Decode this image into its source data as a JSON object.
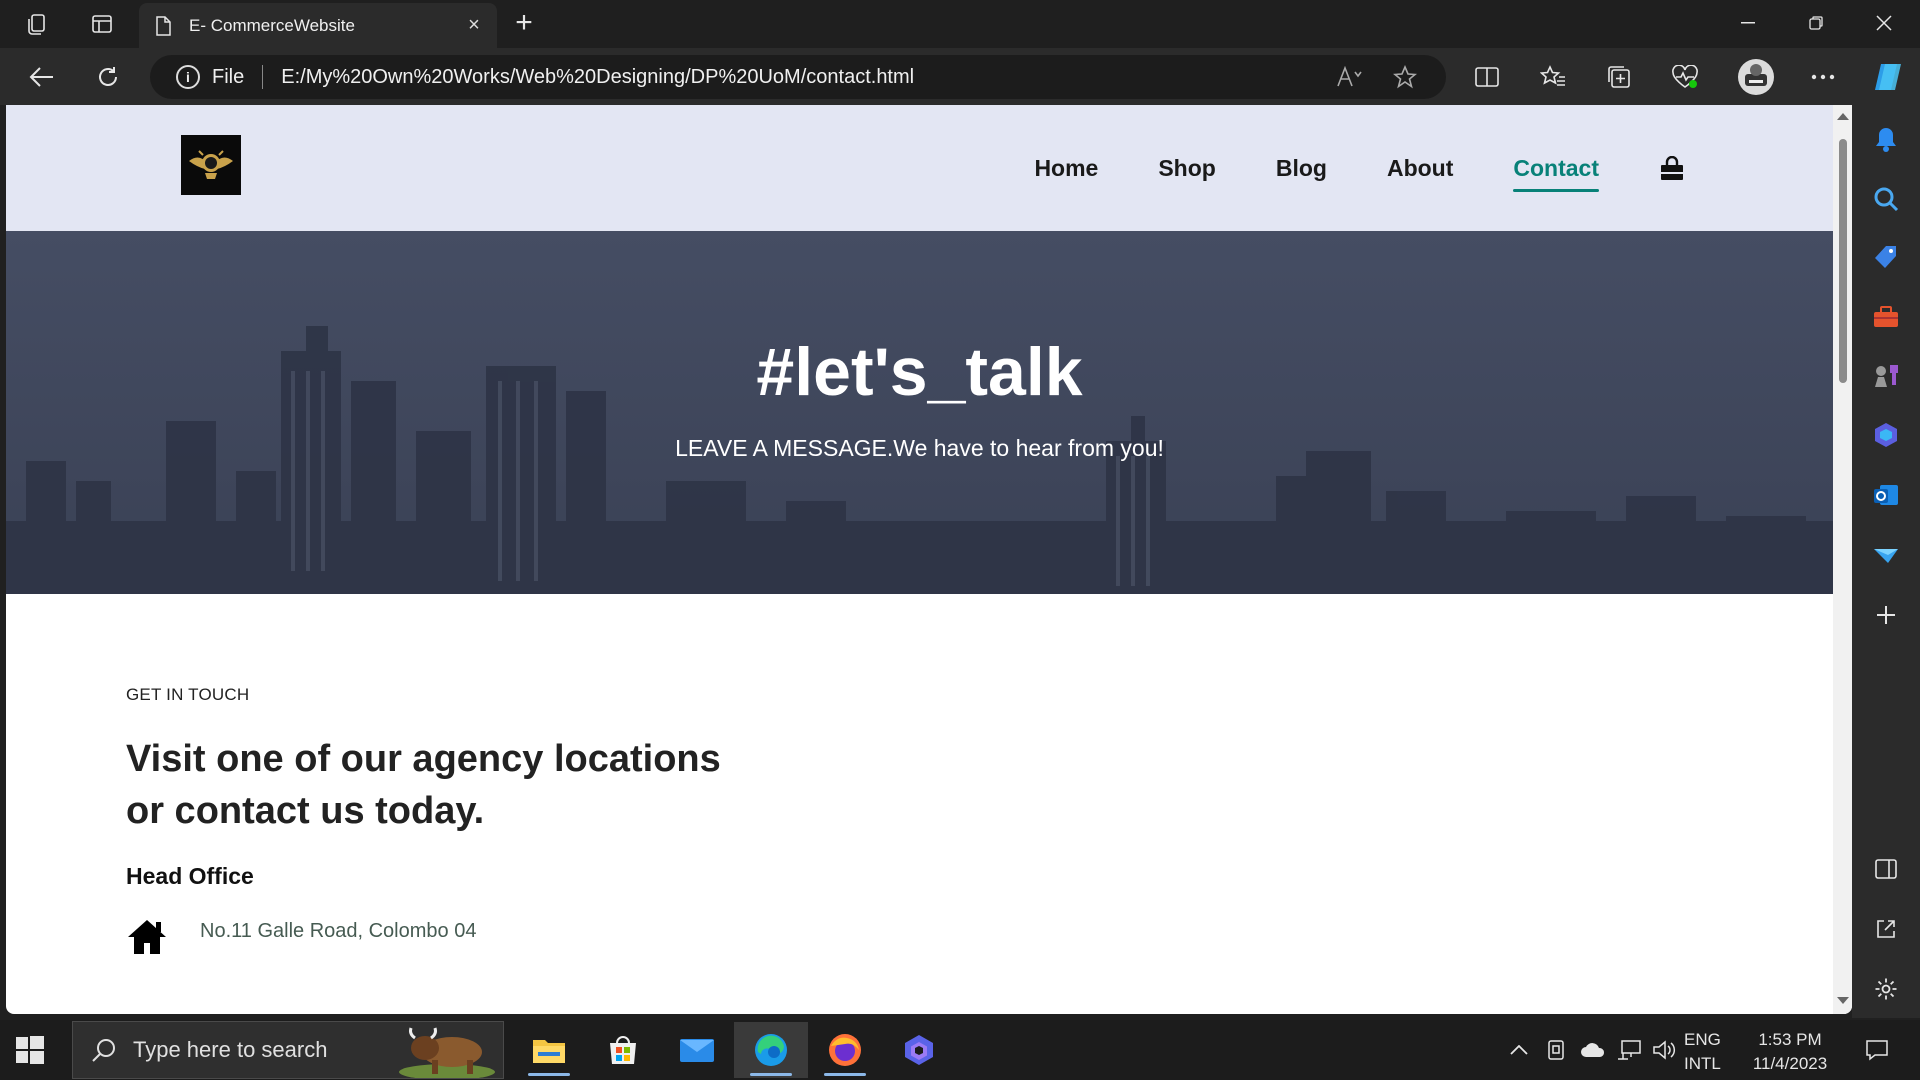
{
  "browser": {
    "tab_title": "E- CommerceWebsite",
    "tab_close": "×",
    "new_tab": "+",
    "url_scheme": "File",
    "url": "E:/My%20Own%20Works/Web%20Designing/DP%20UoM/contact.html",
    "read_aloud_icon": "A⁾"
  },
  "site": {
    "nav": [
      "Home",
      "Shop",
      "Blog",
      "About",
      "Contact"
    ],
    "active_nav": "Contact",
    "accent_color": "#088178",
    "header_bg": "#e3e6f3",
    "hero": {
      "title": "#let's_talk",
      "subtitle": "LEAVE A MESSAGE.We have to hear from you!"
    },
    "contact": {
      "kicker": "GET IN TOUCH",
      "heading_line1": "Visit one of our agency locations",
      "heading_line2": "or contact us today.",
      "office_title": "Head Office",
      "address": "No.11 Galle Road, Colombo 04"
    }
  },
  "taskbar": {
    "search_placeholder": "Type here to search",
    "lang_top": "ENG",
    "lang_bottom": "INTL",
    "time": "1:53 PM",
    "date": "11/4/2023"
  }
}
